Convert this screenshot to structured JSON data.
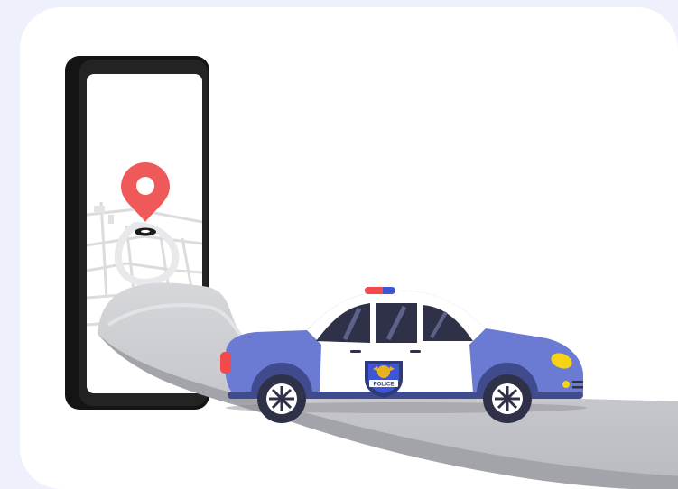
{
  "illustration": {
    "badge_text": "POLICE",
    "colors": {
      "background": "#eef1fb",
      "card": "#ffffff",
      "car_body": "#6b7bd3",
      "car_dark": "#3f4b8c",
      "window": "#2e3148",
      "pin": "#f0595a",
      "road": "#c7c8cc",
      "phone": "#141414",
      "siren_red": "#f24a4a",
      "siren_blue": "#3e56d6",
      "headlight": "#f5d415",
      "badge_gold": "#e8b21e"
    },
    "icons": [
      "location-pin-icon",
      "police-badge-icon"
    ]
  }
}
